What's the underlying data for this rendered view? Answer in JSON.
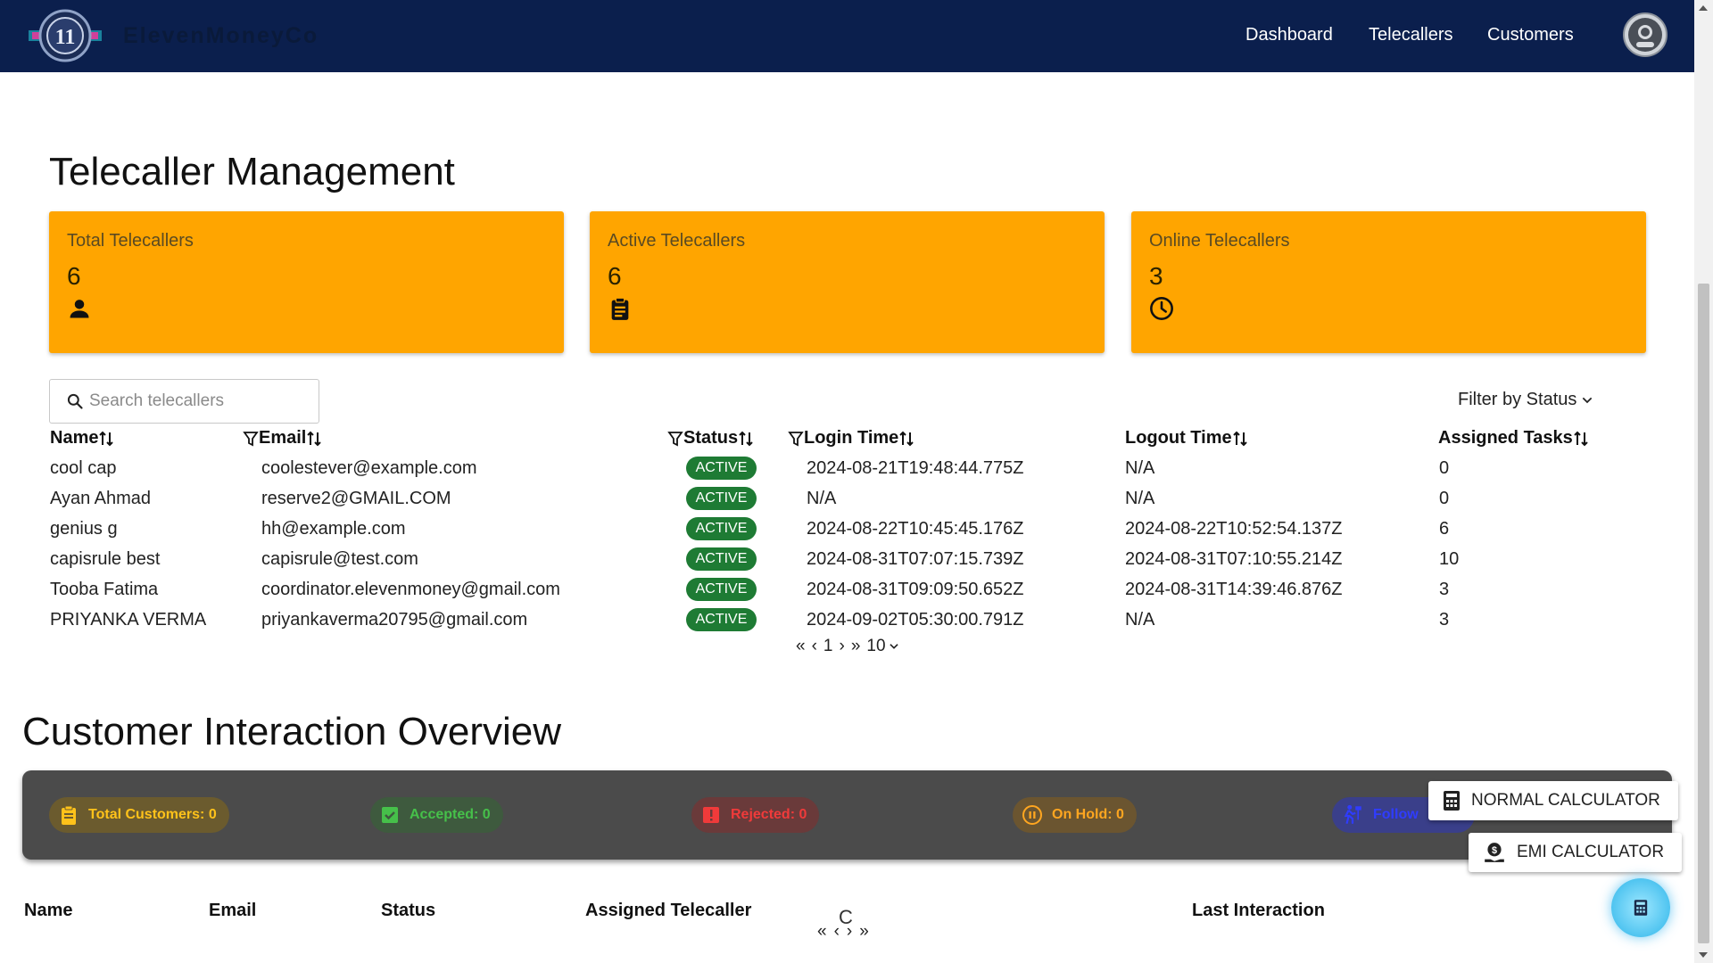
{
  "app": {
    "brand": "ElevenMoneyCo"
  },
  "nav": {
    "items": [
      "Dashboard",
      "Telecallers",
      "Customers"
    ]
  },
  "telecaller_section": {
    "title": "Telecaller Management",
    "cards": [
      {
        "label": "Total Telecallers",
        "value": "6",
        "icon": "person-icon"
      },
      {
        "label": "Active Telecallers",
        "value": "6",
        "icon": "clipboard-icon"
      },
      {
        "label": "Online Telecallers",
        "value": "3",
        "icon": "clock-icon"
      }
    ],
    "search": {
      "placeholder": "Search telecallers"
    },
    "filter_label": "Filter by Status",
    "columns": [
      "Name",
      "Email",
      "Status",
      "Login Time",
      "Logout Time",
      "Assigned Tasks"
    ],
    "rows": [
      {
        "name": "cool cap",
        "email": "coolestever@example.com",
        "status": "ACTIVE",
        "login": "2024-08-21T19:48:44.775Z",
        "logout": "N/A",
        "tasks": "0"
      },
      {
        "name": "Ayan Ahmad",
        "email": "reserve2@GMAIL.COM",
        "status": "ACTIVE",
        "login": "N/A",
        "logout": "N/A",
        "tasks": "0"
      },
      {
        "name": "genius g",
        "email": "hh@example.com",
        "status": "ACTIVE",
        "login": "2024-08-22T10:45:45.176Z",
        "logout": "2024-08-22T10:52:54.137Z",
        "tasks": "6"
      },
      {
        "name": "capisrule best",
        "email": "capisrule@test.com",
        "status": "ACTIVE",
        "login": "2024-08-31T07:07:15.739Z",
        "logout": "2024-08-31T07:10:55.214Z",
        "tasks": "10"
      },
      {
        "name": "Tooba Fatima",
        "email": "coordinator.elevenmoney@gmail.com",
        "status": "ACTIVE",
        "login": "2024-08-31T09:09:50.652Z",
        "logout": "2024-08-31T14:39:46.876Z",
        "tasks": "3"
      },
      {
        "name": "PRIYANKA VERMA",
        "email": "priyankaverma20795@gmail.com",
        "status": "ACTIVE",
        "login": "2024-09-02T05:30:00.791Z",
        "logout": "N/A",
        "tasks": "3"
      }
    ],
    "pager": {
      "first": "«",
      "prev": "‹",
      "page": "1",
      "next": "›",
      "last": "»",
      "per_page": "10"
    }
  },
  "customer_section": {
    "title": "Customer Interaction Overview",
    "pills": [
      {
        "label": "Total Customers: 0",
        "icon": "clipboard-icon"
      },
      {
        "label": "Accepted: 0",
        "icon": "check-icon"
      },
      {
        "label": "Rejected: 0",
        "icon": "exclamation-icon"
      },
      {
        "label": "On Hold: 0",
        "icon": "pause-icon"
      },
      {
        "label": "Follow",
        "icon": "follow-up-icon"
      }
    ],
    "columns": [
      "Name",
      "Email",
      "Status",
      "Assigned Telecaller",
      "Last Interaction"
    ],
    "pager": {
      "first": "«",
      "prev": "‹",
      "next": "›",
      "last": "»"
    },
    "loading_glyph": "C"
  },
  "calculators": {
    "normal": "NORMAL CALCULATOR",
    "emi": "EMI CALCULATOR"
  },
  "colors": {
    "navbar": "#0b1f4d",
    "card": "#ffa500",
    "active_badge": "#1e7b34",
    "dark_bar": "#4b4b4b"
  }
}
